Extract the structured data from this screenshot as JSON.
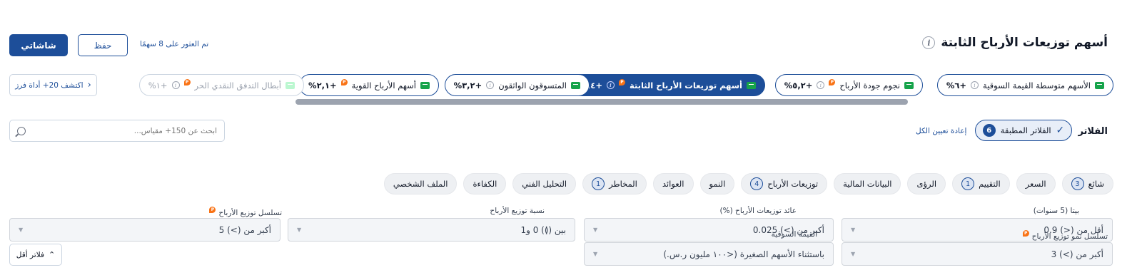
{
  "header": {
    "title": "أسهم توزيعات الأرباح الثابتة",
    "found_text": "تم العثور على 8 سهمًا",
    "save_label": "حفظ",
    "view_label": "شاشاتي"
  },
  "screeners": {
    "explore_label": "اكتشف 20+ أداة فرز",
    "tabs": [
      {
        "label": "الأسهم متوسطة القيمة السوقية",
        "value": "+٦%",
        "state": "normal"
      },
      {
        "label": "نجوم جودة الأرباح",
        "value": "+٥,٢%",
        "state": "normal"
      },
      {
        "label": "أسهم توزيعات الأرباح الثابتة",
        "value": "+٤,٤%",
        "state": "active"
      },
      {
        "label": "المتسوقون الواثقون",
        "value": "+٣,٢%",
        "state": "normal"
      },
      {
        "label": "أسهم الأرباح القوية",
        "value": "+٢,١%",
        "state": "normal"
      },
      {
        "label": "أبطال التدفق النقدي الحر",
        "value": "+١%",
        "state": "faded"
      }
    ]
  },
  "filters": {
    "label": "الفلاتر",
    "applied_label": "الفلاتر المطبقة",
    "applied_count": "6",
    "reset_label": "إعادة تعيين الكل",
    "search_placeholder": "ابحث عن 150+ مقياس...",
    "less_filters_label": "فلاتر أقل"
  },
  "categories": [
    {
      "label": "شائع",
      "badge": "3"
    },
    {
      "label": "السعر",
      "badge": ""
    },
    {
      "label": "التقييم",
      "badge": "1"
    },
    {
      "label": "الرؤى",
      "badge": ""
    },
    {
      "label": "البيانات المالية",
      "badge": ""
    },
    {
      "label": "توزيعات الأرباح",
      "badge": "4"
    },
    {
      "label": "النمو",
      "badge": ""
    },
    {
      "label": "العوائد",
      "badge": ""
    },
    {
      "label": "المخاطر",
      "badge": "1"
    },
    {
      "label": "التحليل الفني",
      "badge": ""
    },
    {
      "label": "الكفاءة",
      "badge": ""
    },
    {
      "label": "الملف الشخصي",
      "badge": ""
    }
  ],
  "fields": [
    {
      "label": "بيتا (5 سنوات)",
      "value": "أقل من (<) 0.9",
      "pro": false
    },
    {
      "label": "عائد توزيعات الأرباح (%)",
      "value": "أكبر من (>) 0.025",
      "pro": false
    },
    {
      "label": "نسبة توزيع الأرباح",
      "value": "بين (≬) 0 و1",
      "pro": false
    },
    {
      "label": "تسلسل توزيع الأرباح",
      "value": "أكبر من (>) 5",
      "pro": true
    },
    {
      "label": "تسلسل نمو توزيع الأرباح",
      "value": "أكبر من (>) 3",
      "pro": true
    },
    {
      "label": "القيمة السوقية",
      "value": "باستثناء الأسهم الصغيرة (<١٠٠ مليون ر.س.)",
      "pro": false
    }
  ],
  "colors": {
    "primary": "#1d4e99",
    "positive_flag": "#16a34a",
    "pro_badge": "#f97316"
  }
}
